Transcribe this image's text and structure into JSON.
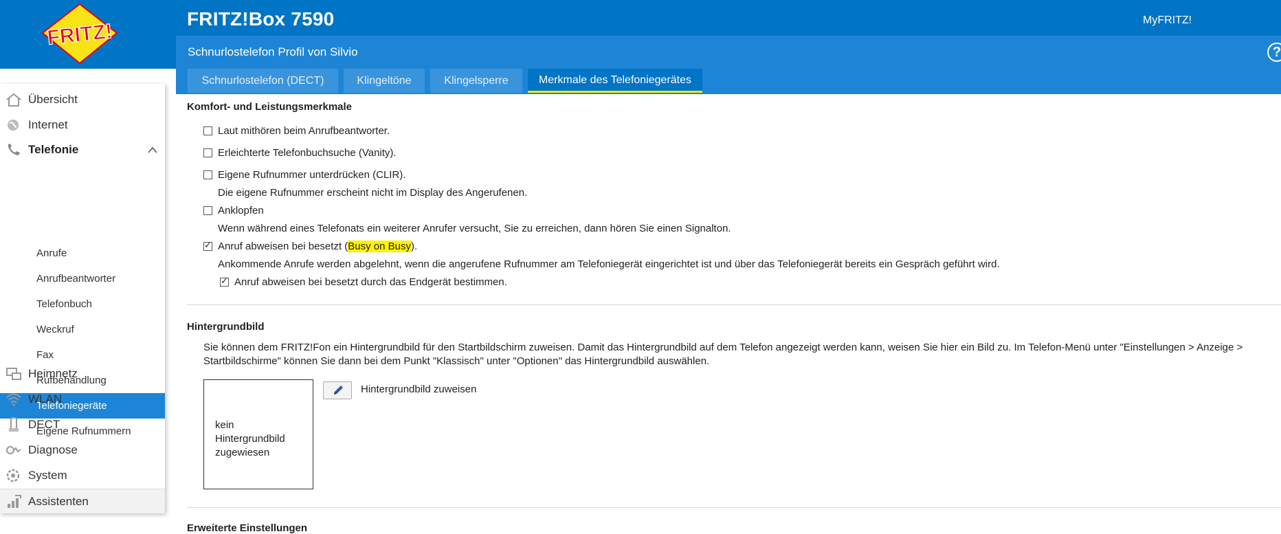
{
  "header": {
    "logo_text": "FRITZ!",
    "product": "FRITZ!Box 7590",
    "myfritz": "MyFRITZ!",
    "page_title": "Schnurlostelefon Profil von Silvio",
    "help": "?"
  },
  "tabs": [
    {
      "label": "Schnurlostelefon (DECT)",
      "active": false
    },
    {
      "label": "Klingeltöne",
      "active": false
    },
    {
      "label": "Klingelsperre",
      "active": false
    },
    {
      "label": "Merkmale des Telefoniegerätes",
      "active": true
    }
  ],
  "sidebar": {
    "items": [
      {
        "label": "Übersicht",
        "icon": "home-icon"
      },
      {
        "label": "Internet",
        "icon": "globe-icon"
      },
      {
        "label": "Telefonie",
        "icon": "phone-icon",
        "expanded": true
      },
      {
        "label": "Heimnetz",
        "icon": "network-icon"
      },
      {
        "label": "WLAN",
        "icon": "wifi-icon"
      },
      {
        "label": "DECT",
        "icon": "dect-icon"
      },
      {
        "label": "Diagnose",
        "icon": "diagnose-icon"
      },
      {
        "label": "System",
        "icon": "system-icon"
      },
      {
        "label": "Assistenten",
        "icon": "assistant-icon"
      }
    ],
    "telefonie_sub": [
      {
        "label": "Anrufe"
      },
      {
        "label": "Anrufbeantworter"
      },
      {
        "label": "Telefonbuch"
      },
      {
        "label": "Weckruf"
      },
      {
        "label": "Fax"
      },
      {
        "label": "Rufbehandlung"
      },
      {
        "label": "Telefoniegeräte",
        "active": true
      },
      {
        "label": "Eigene Rufnummern"
      }
    ]
  },
  "features": {
    "heading": "Komfort- und Leistungsmerkmale",
    "items": [
      {
        "label": "Laut mithören beim Anrufbeantworter.",
        "checked": false
      },
      {
        "label": "Erleichterte Telefonbuchsuche (Vanity).",
        "checked": false
      },
      {
        "label": "Eigene Rufnummer unterdrücken (CLIR).",
        "checked": false,
        "desc": "Die eigene Rufnummer erscheint nicht im Display des Angerufenen."
      },
      {
        "label": "Anklopfen",
        "checked": false,
        "desc": "Wenn während eines Telefonats ein weiterer Anrufer versucht, Sie zu erreichen, dann hören Sie einen Signalton."
      },
      {
        "label_pre": "Anruf abweisen bei besetzt (",
        "label_hl": "Busy on Busy",
        "label_post": ").",
        "checked": true,
        "desc": "Ankommende Anrufe werden abgelehnt, wenn die angerufene Rufnummer am Telefoniegerät eingerichtet ist und über das Telefoniegerät bereits ein Gespräch geführt wird."
      }
    ],
    "sub_option": {
      "label": "Anruf abweisen bei besetzt durch das Endgerät bestimmen.",
      "checked": true
    }
  },
  "background": {
    "heading": "Hintergrundbild",
    "text_line1": "Sie können dem FRITZ!Fon ein Hintergrundbild für den Startbildschirm zuweisen. Damit das Hintergrundbild auf dem Telefon angezeigt werden kann, weisen Sie hier ein Bild zu. Im Telefon-Menü unter \"Einstellungen > Anzeige >",
    "text_line2": "Startbildschirme\" können Sie dann bei dem Punkt \"Klassisch\" unter \"Optionen\" das Hintergrundbild auswählen.",
    "preview_text": "kein Hintergrundbild zugewiesen",
    "assign_label": "Hintergrundbild zuweisen"
  },
  "next_section": {
    "heading": "Erweiterte Einstellungen"
  },
  "colors": {
    "brand_blue": "#0074c5",
    "tab_blue": "#3a94dc",
    "highlight": "#fff200",
    "active_underline": "#f2e600"
  }
}
